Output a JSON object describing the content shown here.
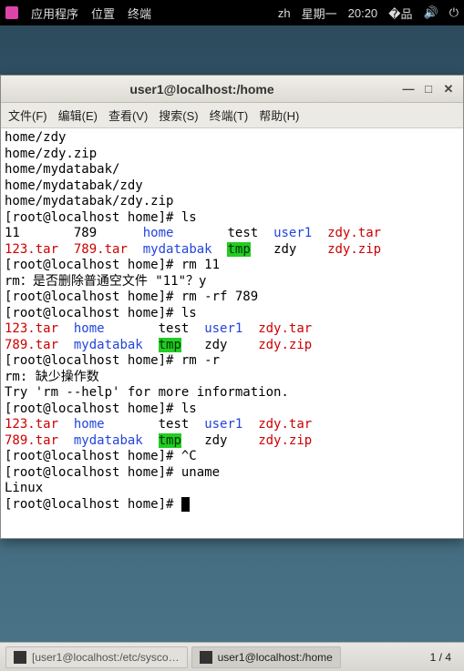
{
  "top_panel": {
    "apps": "应用程序",
    "places": "位置",
    "terminal": "终端",
    "lang": "zh",
    "day": "星期一",
    "time": "20:20"
  },
  "window": {
    "title": "user1@localhost:/home",
    "menu": {
      "file": "文件(F)",
      "edit": "编辑(E)",
      "view": "查看(V)",
      "search": "搜索(S)",
      "terminal": "终端(T)",
      "help": "帮助(H)"
    }
  },
  "term": {
    "l0": "home/zdy",
    "l1": "home/zdy.zip",
    "l2": "home/mydatabak/",
    "l3": "home/mydatabak/zdy",
    "l4": "home/mydatabak/zdy.zip",
    "p1": "[root@localhost home]# ",
    "c1": "ls",
    "ls1": {
      "a": "11",
      "b": "789",
      "c": "home",
      "d": "test",
      "e": "user1",
      "f": "zdy.tar",
      "g": "123.tar",
      "h": "789.tar",
      "i": "mydatabak",
      "j": "tmp",
      "k": "zdy",
      "l": "zdy.zip"
    },
    "c2": "rm 11",
    "rm1a": "rm：是否删除普通空文件 \"11\"？",
    "rm1y": "y",
    "c3": "rm -rf 789",
    "c4": "ls",
    "ls2": {
      "a": "123.tar",
      "b": "home",
      "c": "test",
      "d": "user1",
      "e": "zdy.tar",
      "f": "789.tar",
      "g": "mydatabak",
      "h": "tmp",
      "i": "zdy",
      "j": "zdy.zip"
    },
    "c5": "rm -r",
    "err1": "rm: 缺少操作数",
    "err2": "Try 'rm --help' for more information.",
    "c6": "ls",
    "c7": "^C",
    "c8": "uname",
    "out8": "Linux"
  },
  "taskbar": {
    "task1": "[user1@localhost:/etc/sysco…",
    "task2": "user1@localhost:/home",
    "workspace": "1 / 4"
  }
}
